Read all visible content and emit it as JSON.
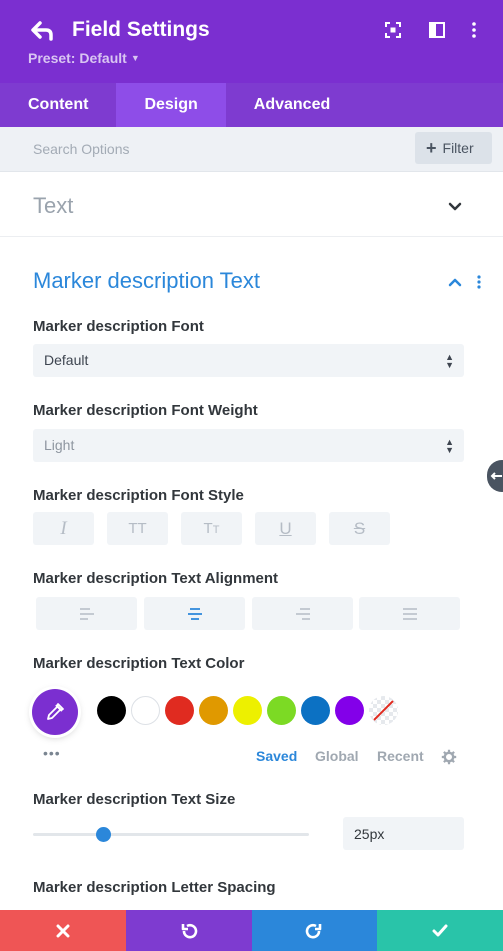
{
  "header": {
    "title": "Field Settings",
    "preset_label": "Preset: Default",
    "bg_color": "#7b2fd0"
  },
  "tabs": [
    {
      "label": "Content",
      "active": false
    },
    {
      "label": "Design",
      "active": true
    },
    {
      "label": "Advanced",
      "active": false
    }
  ],
  "search": {
    "placeholder": "Search Options",
    "filter_label": "Filter"
  },
  "sections": {
    "text": {
      "label": "Text",
      "expanded": false
    },
    "marker_text": {
      "label": "Marker description Text",
      "expanded": true
    }
  },
  "fields": {
    "font": {
      "label": "Marker description Font",
      "value": "Default"
    },
    "font_weight": {
      "label": "Marker description Font Weight",
      "value": "Light"
    },
    "font_style": {
      "label": "Marker description Font Style",
      "options": [
        "italic",
        "uppercase",
        "capitalize",
        "underline",
        "strikethrough"
      ]
    },
    "text_alignment": {
      "label": "Marker description Text Alignment",
      "options": [
        "left",
        "center",
        "right",
        "justify"
      ],
      "selected": "center"
    },
    "text_color": {
      "label": "Marker description Text Color",
      "picker_color": "#7b2fd0",
      "swatches": [
        "#000000",
        "#ffffff",
        "#e02b20",
        "#e09900",
        "#edf000",
        "#7cda24",
        "#0c71c3",
        "#8300e9",
        "none"
      ],
      "tabs": [
        {
          "label": "Saved",
          "active": true
        },
        {
          "label": "Global",
          "active": false
        },
        {
          "label": "Recent",
          "active": false
        }
      ]
    },
    "text_size": {
      "label": "Marker description Text Size",
      "value": "25px",
      "slider_fraction": 0.25
    },
    "letter_spacing": {
      "label": "Marker description Letter Spacing"
    }
  },
  "colors": {
    "accent": "#2b87da",
    "footer_cancel": "#ef5555",
    "footer_undo": "#7e3bd0",
    "footer_redo": "#2b87da",
    "footer_save": "#29c4a9"
  }
}
